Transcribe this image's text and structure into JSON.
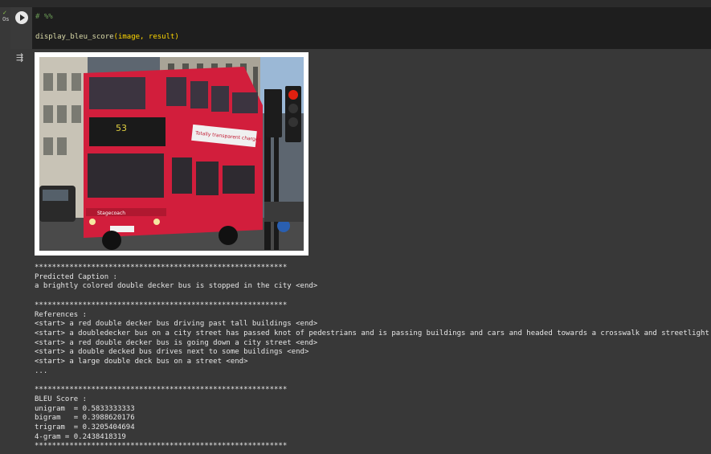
{
  "cell": {
    "exec_time": "0s",
    "status_icon": "check-icon",
    "run_icon": "play-icon",
    "code_comment": "# %%",
    "code_call_fn": "display_bleu_score",
    "code_call_args": "(image, result)"
  },
  "output": {
    "icon": "output-toggle-icon",
    "image_description": "Red double-decker bus on a city street beside traffic lights",
    "bus_sign_text": "Totally transparent charges",
    "bus_brand": "Stagecoach",
    "route_number": "53",
    "separator": "**********************************************************",
    "predicted_label": "Predicted Caption :",
    "predicted_caption": "a brightly colored double decker bus is stopped in the city <end>",
    "references_label": "References :",
    "references": [
      "<start> a red double decker bus driving past tall buildings <end>",
      "<start> a doubledecker bus on a city street has passed knot of pedestrians and is passing buildings and cars and headed towards a crosswalk and streetlight <end>",
      "<start> a red double decker bus is going down a city street <end>",
      "<start> a double decked bus drives next to some buildings <end>",
      "<start> a large double deck bus on a street <end>"
    ],
    "references_ellipsis": "...",
    "bleu_label": "BLEU Score :",
    "bleu_lines": [
      "unigram  = 0.5833333333",
      "bigram   = 0.3988620176",
      "trigram  = 0.3205404694",
      "4-gram = 0.2438418319"
    ]
  },
  "colors": {
    "background": "#383838",
    "code_background": "#1e1e1e",
    "bus_red": "#d21e3c"
  }
}
